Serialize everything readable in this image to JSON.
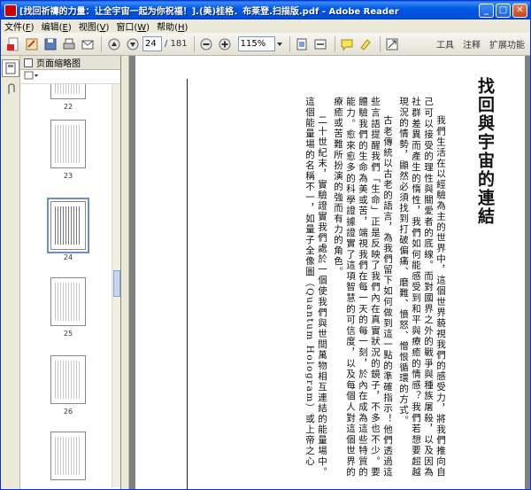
{
  "window": {
    "title": "[找回祈禱的力量：让全宇宙一起为你祝福！].(美)桂格．布莱登.扫描版.pdf - Adobe Reader"
  },
  "menu": [
    {
      "label": "文件(",
      "key": "F",
      "end": ")"
    },
    {
      "label": "编辑(",
      "key": "E",
      "end": ")"
    },
    {
      "label": "视图(",
      "key": "V",
      "end": ")"
    },
    {
      "label": "窗口(",
      "key": "W",
      "end": ")"
    },
    {
      "label": "帮助(",
      "key": "H",
      "end": ")"
    }
  ],
  "toolbar": {
    "page_current": "24",
    "page_total": "/ 181",
    "zoom": "115%",
    "links": [
      "工具",
      "注释",
      "扩展功能"
    ]
  },
  "sidepanel": {
    "title": "页面缩略图",
    "thumbnails": [
      {
        "label": "22",
        "selected": false
      },
      {
        "label": "23",
        "selected": false
      },
      {
        "label": "24",
        "selected": true
      },
      {
        "label": "25",
        "selected": false
      },
      {
        "label": "26",
        "selected": false
      }
    ]
  },
  "document": {
    "title": "找回與宇宙的連結",
    "paragraphs": [
      "我們生活在以經驗為主的世界中，這個世界藐視我們的感受力，將我們推向自己可以接受的理性與關愛者的底線。而對國界之外的戰爭與種族屠殺，以及因為社群差異而產生的惰性，我們如何能感受到和平與療癒的情感？我們若想要超越現況的情勢，顯然必須找到打破偏痛、磨難、憤怒、憎恨循環的方式。",
      "古老傳統以古老的語言，為我們留下如何做到這一點的準確指示！他們透過這些言語提醒我們「生命」正是反映了我們內在真實狀況的鏡子，不多也不少。要體驗我們的生命為美或苦，端視我們在每一天的每一刻，於內在成為這些特質的能力。愈來愈多的科學證據證實了這項智慧的可信度，以及每個人對這個世界的療癒或苦難所扮演的強而有力的角色。",
      "二十世紀末，實驗證實我們處於一個使我們與世間萬物相互連結的能量場中。這個能量場的名稱不一，如量子全像圖（Quantum Hologram）或上帝之心"
    ]
  }
}
